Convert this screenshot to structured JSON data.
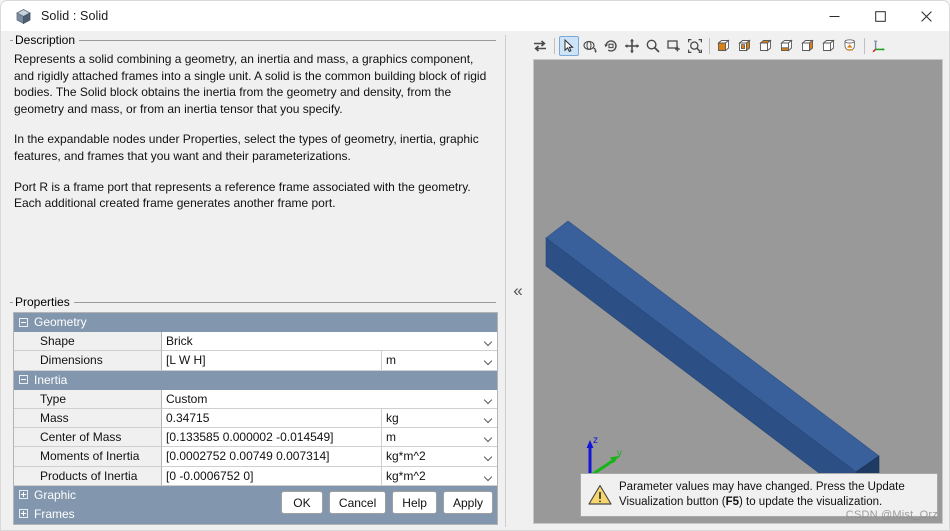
{
  "window": {
    "title": "Solid : Solid",
    "icon": "solid-cube-icon",
    "minimize_label": "—",
    "maximize_label": "□",
    "close_label": "✕"
  },
  "description": {
    "legend": "Description",
    "paragraphs": [
      "Represents a solid combining a geometry, an inertia and mass, a graphics component, and rigidly attached frames into a single unit. A solid is the common building block of rigid bodies. The Solid block obtains the inertia from the geometry and density, from the geometry and mass, or from an inertia tensor that you specify.",
      "In the expandable nodes under Properties, select the types of geometry, inertia, graphic features, and frames that you want and their parameterizations.",
      "Port R is a frame port that represents a reference frame associated with the geometry. Each additional created frame generates another frame port."
    ]
  },
  "properties": {
    "legend": "Properties",
    "sections": [
      {
        "name": "Geometry",
        "expanded": true,
        "expander": "minus",
        "rows": [
          {
            "name": "Shape",
            "value": "Brick",
            "unit": ""
          },
          {
            "name": "Dimensions",
            "value": "[L W H]",
            "unit": "m"
          }
        ]
      },
      {
        "name": "Inertia",
        "expanded": true,
        "expander": "minus",
        "rows": [
          {
            "name": "Type",
            "value": "Custom",
            "unit": ""
          },
          {
            "name": "Mass",
            "value": "0.34715",
            "unit": "kg"
          },
          {
            "name": "Center of Mass",
            "value": "[0.133585 0.000002 -0.014549]",
            "unit": "m"
          },
          {
            "name": "Moments of Inertia",
            "value": "[0.0002752 0.00749 0.007314]",
            "unit": "kg*m^2"
          },
          {
            "name": "Products of Inertia",
            "value": "[0 -0.0006752 0]",
            "unit": "kg*m^2"
          }
        ]
      },
      {
        "name": "Graphic",
        "expanded": false,
        "expander": "plus",
        "rows": []
      },
      {
        "name": "Frames",
        "expanded": false,
        "expander": "plus",
        "rows": []
      }
    ]
  },
  "dialog_buttons": [
    {
      "label": "OK",
      "name": "ok-button"
    },
    {
      "label": "Cancel",
      "name": "cancel-button"
    },
    {
      "label": "Help",
      "name": "help-button"
    },
    {
      "label": "Apply",
      "name": "apply-button"
    }
  ],
  "splitter": {
    "collapse_label": "«"
  },
  "viewer": {
    "toolbar": [
      {
        "name": "swap-panels-icon",
        "type": "swap"
      },
      {
        "name": "separator",
        "type": "sep"
      },
      {
        "name": "select-tool-icon",
        "type": "cursor",
        "active": true
      },
      {
        "name": "rotate-view-icon",
        "type": "rotate"
      },
      {
        "name": "orbit-view-icon",
        "type": "orbit"
      },
      {
        "name": "pan-view-icon",
        "type": "pan"
      },
      {
        "name": "zoom-icon",
        "type": "zoom"
      },
      {
        "name": "zoom-region-icon",
        "type": "zoomregion"
      },
      {
        "name": "zoom-fit-icon",
        "type": "zoomfit"
      },
      {
        "name": "separator",
        "type": "sep"
      },
      {
        "name": "view-front-icon",
        "type": "cube",
        "variant": 1
      },
      {
        "name": "view-back-icon",
        "type": "cube",
        "variant": 2
      },
      {
        "name": "view-left-icon",
        "type": "cube",
        "variant": 3
      },
      {
        "name": "view-right-icon",
        "type": "cube",
        "variant": 4
      },
      {
        "name": "view-top-icon",
        "type": "cube",
        "variant": 5
      },
      {
        "name": "view-bottom-icon",
        "type": "cube",
        "variant": 6
      },
      {
        "name": "view-isometric-icon",
        "type": "isocube"
      },
      {
        "name": "separator",
        "type": "sep"
      },
      {
        "name": "toggle-axes-triad-icon",
        "type": "triad"
      }
    ],
    "background_color": "#999999",
    "solid_color": "#2f5a96",
    "axes": {
      "x_label": "x",
      "y_label": "y",
      "z_label": "z",
      "x_color": "#e01010",
      "y_color": "#16b516",
      "z_color": "#1414d8"
    },
    "warning": {
      "icon": "warning-triangle-icon",
      "line1_a": "Parameter values may have changed. Press the Update",
      "line2_a": "Visualization button (",
      "line2_key": "F5",
      "line2_b": ") to update the visualization."
    }
  },
  "watermark": "CSDN @Mist_Orz"
}
